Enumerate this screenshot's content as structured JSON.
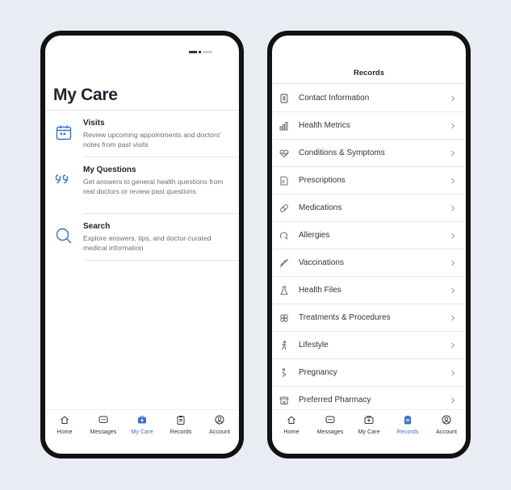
{
  "left_screen": {
    "title": "My Care",
    "items": [
      {
        "title": "Visits",
        "description": "Review upcoming appointments and doctors' notes from past visits",
        "icon": "calendar-icon"
      },
      {
        "title": "My Questions",
        "description": "Get answers to general health questions from real doctors or review past questions",
        "icon": "quote-icon"
      },
      {
        "title": "Search",
        "description": "Explore answers, tips, and doctor-curated medical information",
        "icon": "search-icon"
      }
    ],
    "nav": [
      {
        "label": "Home",
        "icon": "home-icon",
        "active": false
      },
      {
        "label": "Messages",
        "icon": "messages-icon",
        "active": false
      },
      {
        "label": "My Care",
        "icon": "medical-bag-icon",
        "active": true
      },
      {
        "label": "Records",
        "icon": "clipboard-icon",
        "active": false
      },
      {
        "label": "Account",
        "icon": "account-icon",
        "active": false
      }
    ]
  },
  "right_screen": {
    "title": "Records",
    "items": [
      {
        "label": "Contact Information",
        "icon": "contact-book-icon"
      },
      {
        "label": "Health Metrics",
        "icon": "bar-chart-icon"
      },
      {
        "label": "Conditions & Symptoms",
        "icon": "heartbeat-icon"
      },
      {
        "label": "Prescriptions",
        "icon": "prescription-icon"
      },
      {
        "label": "Medications",
        "icon": "pill-icon"
      },
      {
        "label": "Allergies",
        "icon": "allergy-icon"
      },
      {
        "label": "Vaccinations",
        "icon": "syringe-icon"
      },
      {
        "label": "Health Files",
        "icon": "flask-icon"
      },
      {
        "label": "Treatments & Procedures",
        "icon": "treatment-icon"
      },
      {
        "label": "Lifestyle",
        "icon": "figure-icon"
      },
      {
        "label": "Pregnancy",
        "icon": "pregnancy-icon"
      },
      {
        "label": "Preferred Pharmacy",
        "icon": "pharmacy-icon"
      }
    ],
    "nav": [
      {
        "label": "Home",
        "icon": "home-icon",
        "active": false
      },
      {
        "label": "Messages",
        "icon": "messages-icon",
        "active": false
      },
      {
        "label": "My Care",
        "icon": "medical-bag-icon",
        "active": false
      },
      {
        "label": "Records",
        "icon": "clipboard-icon",
        "active": true
      },
      {
        "label": "Account",
        "icon": "account-icon",
        "active": false
      }
    ]
  },
  "colors": {
    "accent": "#3a72c7",
    "text": "#1f2230",
    "muted": "#6b6e78",
    "frame": "#121212",
    "background": "#e9ecf2"
  }
}
